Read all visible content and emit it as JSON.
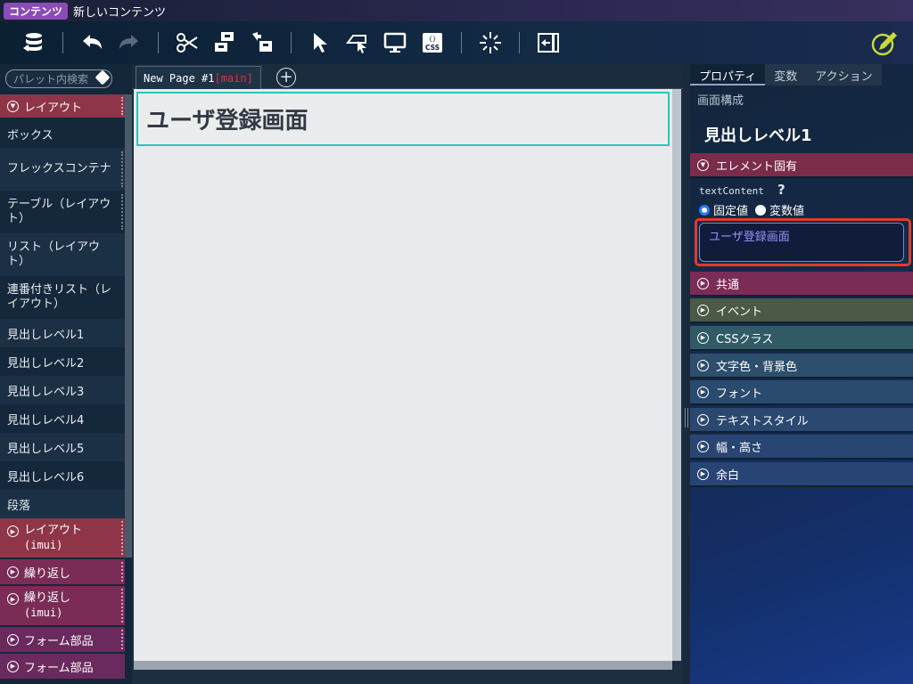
{
  "titlebar": {
    "badge": "コンテンツ",
    "title": "新しいコンテンツ"
  },
  "toolbar": {
    "buttons": [
      "database-icon",
      "undo-icon",
      "redo-icon",
      "scissors-icon",
      "component-icon",
      "extract-icon",
      "pointer-icon",
      "select-box-icon",
      "monitor-icon",
      "css-icon",
      "sparkle-icon",
      "exit-panel-icon"
    ],
    "accent": "#c8d838"
  },
  "palette": {
    "search_placeholder": "パレット内検索",
    "section_layout": "レイアウト",
    "items": [
      "ボックス",
      "フレックスコンテナ",
      "テーブル（レイアウト）",
      "リスト（レイアウト）",
      "連番付きリスト（レイアウト）",
      "見出しレベル1",
      "見出しレベル2",
      "見出しレベル3",
      "見出しレベル4",
      "見出しレベル5",
      "見出しレベル6",
      "段落"
    ],
    "sections_collapsed": [
      {
        "label": "レイアウト",
        "sub": "(imui)"
      },
      {
        "label": "繰り返し",
        "sub": ""
      },
      {
        "label": "繰り返し",
        "sub": "(imui)"
      },
      {
        "label": "フォーム部品",
        "sub": ""
      },
      {
        "label": "フォーム部品",
        "sub": ""
      }
    ]
  },
  "editor": {
    "tab_name": "New Page #1",
    "tab_suffix": "[main]",
    "heading_text": "ユーザ登録画面"
  },
  "properties": {
    "tabs": [
      "プロパティ",
      "変数",
      "アクション"
    ],
    "subtab": "画面構成",
    "title": "見出しレベル1",
    "section_element": "エレメント固有",
    "field_label": "textContent",
    "help": "?",
    "radio_fixed": "固定値",
    "radio_variable": "変数値",
    "text_value": "ユーザ登録画面",
    "sections": [
      "共通",
      "イベント",
      "CSSクラス",
      "文字色・背景色",
      "フォント",
      "テキストスタイル",
      "幅・高さ",
      "余白"
    ]
  }
}
